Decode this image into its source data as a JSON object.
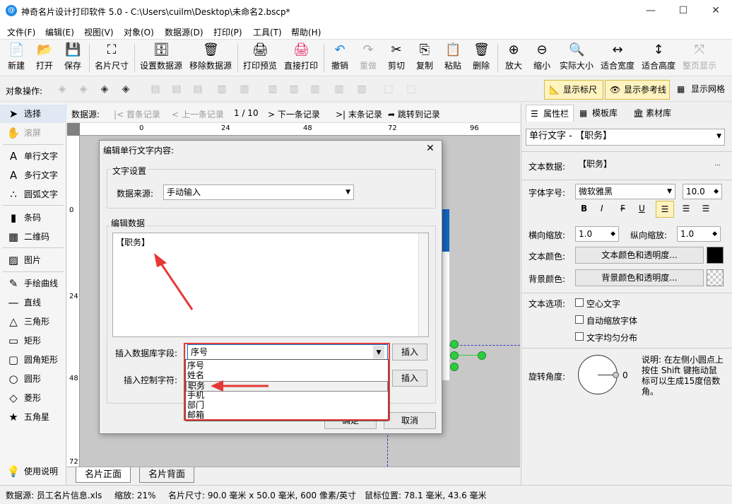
{
  "window": {
    "title": "神奇名片设计打印软件 5.0 - C:\\Users\\cuilm\\Desktop\\未命名2.bscp*",
    "app_icon": "@",
    "min": "—",
    "max": "☐",
    "close": "✕"
  },
  "menu": [
    "文件(F)",
    "编辑(E)",
    "视图(V)",
    "对象(O)",
    "数据源(D)",
    "打印(P)",
    "工具(T)",
    "帮助(H)"
  ],
  "toolbar": [
    {
      "label": "新建",
      "icon": "📄"
    },
    {
      "label": "打开",
      "icon": "📂"
    },
    {
      "label": "保存",
      "icon": "💾"
    },
    {
      "label": "名片尺寸",
      "icon": "⛶"
    },
    {
      "label": "设置数据源",
      "icon": "🗄"
    },
    {
      "label": "移除数据源",
      "icon": "🗑"
    },
    {
      "label": "打印预览",
      "icon": "🖨"
    },
    {
      "label": "直接打印",
      "icon": "🖨"
    },
    {
      "label": "撤销",
      "icon": "↶"
    },
    {
      "label": "重做",
      "icon": "↷"
    },
    {
      "label": "剪切",
      "icon": "✂"
    },
    {
      "label": "复制",
      "icon": "⎘"
    },
    {
      "label": "粘贴",
      "icon": "📋"
    },
    {
      "label": "删除",
      "icon": "🗑"
    },
    {
      "label": "放大",
      "icon": "⊕"
    },
    {
      "label": "缩小",
      "icon": "⊖"
    },
    {
      "label": "实际大小",
      "icon": "🔍"
    },
    {
      "label": "适合宽度",
      "icon": "↔"
    },
    {
      "label": "适合高度",
      "icon": "↕"
    },
    {
      "label": "整页显示",
      "icon": "⤧"
    }
  ],
  "objbar": {
    "label": "对象操作:",
    "show_ruler": "显示标尺",
    "show_guides": "显示参考线",
    "show_grid": "显示网格"
  },
  "tools": [
    {
      "label": "选择",
      "icon": "➤"
    },
    {
      "label": "滚屏",
      "icon": "✋"
    },
    {
      "label": "单行文字",
      "icon": "A"
    },
    {
      "label": "多行文字",
      "icon": "A"
    },
    {
      "label": "圆弧文字",
      "icon": "∴"
    },
    {
      "label": "条码",
      "icon": "▮"
    },
    {
      "label": "二维码",
      "icon": "▦"
    },
    {
      "label": "图片",
      "icon": "▨"
    },
    {
      "label": "手绘曲线",
      "icon": "✎"
    },
    {
      "label": "直线",
      "icon": "—"
    },
    {
      "label": "三角形",
      "icon": "△"
    },
    {
      "label": "矩形",
      "icon": "▭"
    },
    {
      "label": "圆角矩形",
      "icon": "▢"
    },
    {
      "label": "圆形",
      "icon": "○"
    },
    {
      "label": "菱形",
      "icon": "◇"
    },
    {
      "label": "五角星",
      "icon": "★"
    },
    {
      "label": "使用说明",
      "icon": "💡"
    }
  ],
  "records": {
    "source_label": "数据源:",
    "first": "首条记录",
    "prev": "上一条记录",
    "page": "1 / 10",
    "next": "下一条记录",
    "last": "末条记录",
    "jump": "跳转到记录"
  },
  "ruler": {
    "top": [
      "0",
      "24",
      "48",
      "72",
      "96"
    ],
    "left": [
      "0",
      "24",
      "48",
      "72"
    ]
  },
  "page_tabs": [
    "名片正面",
    "名片背面"
  ],
  "right": {
    "tabs": [
      "属性栏",
      "模板库",
      "素材库"
    ],
    "object": "单行文字 - 【职务】",
    "text_data_label": "文本数据:",
    "text_data": "【职务】",
    "more": "...",
    "font_label": "字体字号:",
    "font": "微软雅黑",
    "size": "10.0",
    "bold": "B",
    "italic": "I",
    "strike": "F",
    "underline": "U",
    "hscale_label": "横向缩放:",
    "hscale": "1.0",
    "vscale_label": "纵向缩放:",
    "vscale": "1.0",
    "text_color_label": "文本颜色:",
    "text_color_btn": "文本颜色和透明度...",
    "bg_color_label": "背景颜色:",
    "bg_color_btn": "背景颜色和透明度...",
    "text_opts_label": "文本选项:",
    "opt1": "空心文字",
    "opt2": "自动缩放字体",
    "opt3": "文字均匀分布",
    "rotate_label": "旋转角度:",
    "rotate_value": "0",
    "rotate_note": "说明: 在左侧小圆点上按住 Shift 键拖动鼠标可以生成15度倍数角。",
    "text_color": "#000000"
  },
  "status": {
    "source": "数据源: 员工名片信息.xls",
    "zoom": "缩放: 21%",
    "size": "名片尺寸: 90.0 毫米 x 50.0 毫米, 600 像素/英寸",
    "pos": "鼠标位置: 78.1 毫米, 43.6 毫米"
  },
  "dialog": {
    "title": "编辑单行文字内容:",
    "close": "✕",
    "group1": "文字设置",
    "source_label": "数据来源:",
    "source": "手动输入",
    "group2": "编辑数据",
    "content": "【职务】",
    "insert_db_label": "插入数据库字段:",
    "insert_db_value": "序号",
    "insert_btn": "插入",
    "insert_ctrl_label": "插入控制字符:",
    "insert_btn2": "插入",
    "ok": "确定",
    "cancel": "取消",
    "dropdown": [
      "序号",
      "姓名",
      "职务",
      "手机",
      "部门",
      "邮箱"
    ]
  }
}
